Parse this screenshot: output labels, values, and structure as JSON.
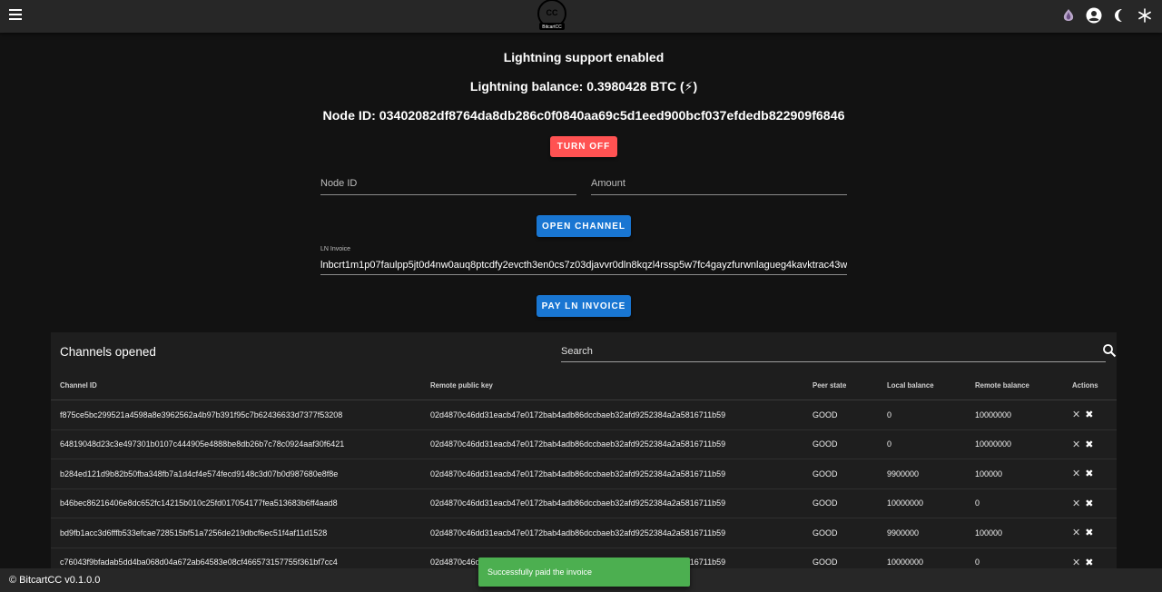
{
  "header": {
    "logo_text": "BitcartCC"
  },
  "lightning": {
    "status": "Lightning support enabled",
    "balance": "Lightning balance: 0.3980428 BTC (⚡)",
    "node_id": "Node ID: 03402082df8764da8db286c0f0840aa69c5d1eed900bcf037efdedb822909f6846",
    "turn_off_label": "TURN OFF"
  },
  "form": {
    "node_id_placeholder": "Node ID",
    "amount_placeholder": "Amount",
    "open_channel_label": "OPEN CHANNEL",
    "ln_invoice_label": "LN Invoice",
    "ln_invoice_value": "lnbcrt1m1p07faulpp5jt0d4nw0auq8ptcdfy2evcth3en0cs7z03djavvr0dln8kqzl4rssp5w7fc4gayzfurwnlagueg4kavktrac43w",
    "pay_label": "PAY LN INVOICE"
  },
  "channels": {
    "title": "Channels opened",
    "search_placeholder": "Search",
    "columns": [
      "Channel ID",
      "Remote public key",
      "Peer state",
      "Local balance",
      "Remote balance",
      "Actions"
    ],
    "rows": [
      [
        "f875ce5bc299521a4598a8e3962562a4b97b391f95c7b62436633d7377f53208",
        "02d4870c46dd31eacb47e0172bab4adb86dccbaeb32afd9252384a2a5816711b59",
        "GOOD",
        "0",
        "10000000"
      ],
      [
        "64819048d23c3e497301b0107c444905e4888be8db26b7c78c0924aaf30f6421",
        "02d4870c46dd31eacb47e0172bab4adb86dccbaeb32afd9252384a2a5816711b59",
        "GOOD",
        "0",
        "10000000"
      ],
      [
        "b284ed121d9b82b50fba348fb7a1d4cf4e574fecd9148c3d07b0d987680e8f8e",
        "02d4870c46dd31eacb47e0172bab4adb86dccbaeb32afd9252384a2a5816711b59",
        "GOOD",
        "9900000",
        "100000"
      ],
      [
        "b46bec86216406e8dc652fc14215b010c25fd017054177fea513683b6ff4aad8",
        "02d4870c46dd31eacb47e0172bab4adb86dccbaeb32afd9252384a2a5816711b59",
        "GOOD",
        "10000000",
        "0"
      ],
      [
        "bd9fb1acc3d6fffb533efcae728515bf51a7256de219dbcf6ec51f4af11d1528",
        "02d4870c46dd31eacb47e0172bab4adb86dccbaeb32afd9252384a2a5816711b59",
        "GOOD",
        "9900000",
        "100000"
      ],
      [
        "c76043f9bfadab5dd4ba068d04a672ab64583e08cf466573157755f361bf7cc4",
        "02d4870c46dd31eacb47e0172bab4adb86dccbaeb32afd9252384a2a5816711b59",
        "GOOD",
        "10000000",
        "0"
      ]
    ]
  },
  "footer": {
    "text": "© BitcartCC v0.1.0.0"
  },
  "snackbar": {
    "text": "Successfully paid the invoice"
  }
}
